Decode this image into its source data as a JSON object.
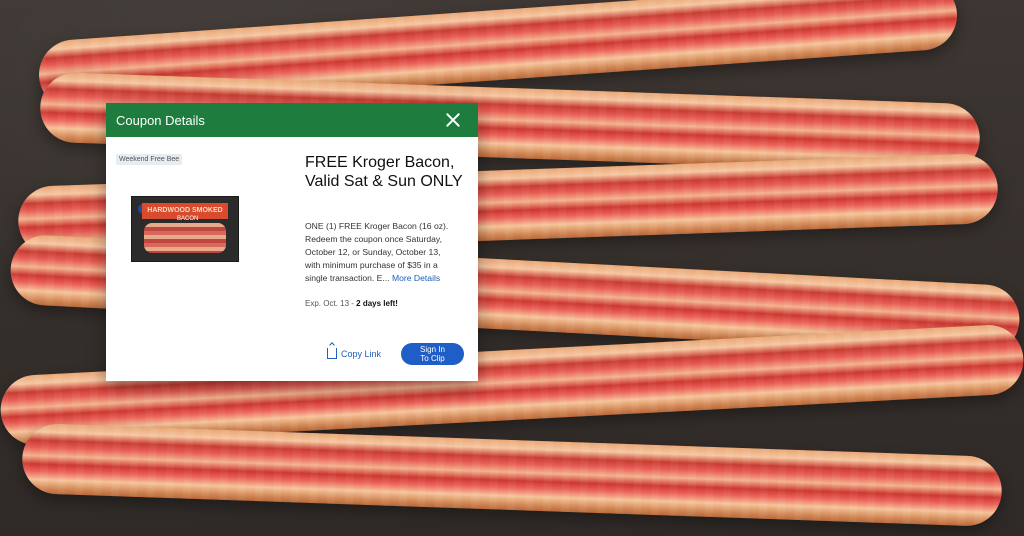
{
  "modal": {
    "title": "Coupon Details",
    "badge": "Weekend Free Bee",
    "product_label": "HARDWOOD SMOKED",
    "product_sub": "BACON",
    "coupon_title": "FREE Kroger Bacon, Valid Sat & Sun ONLY",
    "description": "ONE (1) FREE Kroger Bacon (16 oz). Redeem the coupon once Saturday, October 12, or Sunday, October 13, with minimum purchase of $35 in a single transaction. E...",
    "more_details_label": "More Details",
    "expiration": "Exp. Oct. 13",
    "days_left": "2 days left!",
    "copy_link_label": "Copy Link",
    "clip_button_label": "Sign In\nTo Clip"
  },
  "colors": {
    "header_green": "#1e7d3e",
    "link_blue": "#1e5fb8",
    "button_blue": "#1f5ec6"
  },
  "icons": {
    "close": "close-icon",
    "copy": "copy-link-icon"
  }
}
